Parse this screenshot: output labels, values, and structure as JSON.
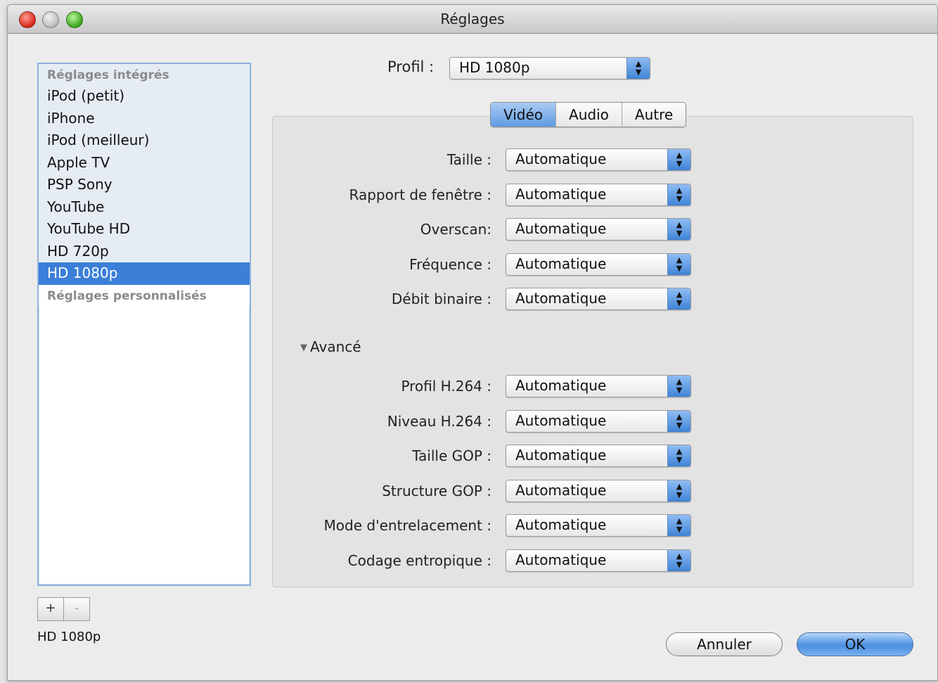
{
  "window": {
    "title": "Réglages"
  },
  "sidebar": {
    "group_builtin": "Réglages intégrés",
    "items": [
      {
        "label": "iPod (petit)"
      },
      {
        "label": "iPhone"
      },
      {
        "label": "iPod (meilleur)"
      },
      {
        "label": "Apple TV"
      },
      {
        "label": "PSP Sony"
      },
      {
        "label": "YouTube"
      },
      {
        "label": "YouTube HD"
      },
      {
        "label": "HD 720p"
      },
      {
        "label": "HD 1080p",
        "selected": true
      }
    ],
    "group_custom": "Réglages personnalisés",
    "add_label": "+",
    "remove_label": "-",
    "status": "HD 1080p"
  },
  "profile": {
    "label": "Profil :",
    "value": "HD 1080p"
  },
  "tabs": [
    {
      "label": "Vidéo",
      "active": true
    },
    {
      "label": "Audio"
    },
    {
      "label": "Autre"
    }
  ],
  "video_settings": [
    {
      "label": "Taille :",
      "value": "Automatique"
    },
    {
      "label": "Rapport de fenêtre :",
      "value": "Automatique"
    },
    {
      "label": "Overscan:",
      "value": "Automatique"
    },
    {
      "label": "Fréquence :",
      "value": "Automatique"
    },
    {
      "label": "Débit binaire :",
      "value": "Automatique"
    }
  ],
  "advanced": {
    "label": "Avancé",
    "expanded": true,
    "settings": [
      {
        "label": "Profil H.264 :",
        "value": "Automatique"
      },
      {
        "label": "Niveau H.264 :",
        "value": "Automatique"
      },
      {
        "label": "Taille GOP :",
        "value": "Automatique"
      },
      {
        "label": "Structure GOP :",
        "value": "Automatique"
      },
      {
        "label": "Mode d'entrelacement :",
        "value": "Automatique"
      },
      {
        "label": "Codage entropique :",
        "value": "Automatique"
      }
    ]
  },
  "buttons": {
    "cancel": "Annuler",
    "ok": "OK"
  },
  "colors": {
    "selection": "#3b7fd9",
    "accent": "#4a8fe2",
    "close": "#d8261a",
    "zoom": "#3aa51c"
  },
  "icons": {
    "stepper_up": "▲",
    "stepper_down": "▼",
    "disclosure": "▼"
  }
}
